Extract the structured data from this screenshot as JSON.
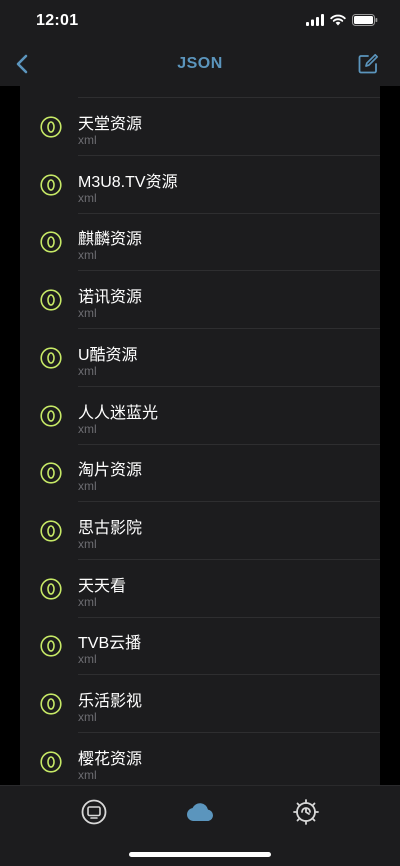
{
  "status_bar": {
    "time": "12:01"
  },
  "nav": {
    "title": "JSON",
    "back_icon": "chevron-left-icon",
    "edit_icon": "compose-icon"
  },
  "colors": {
    "accent": "#5b95bd",
    "item_icon": "#c6e866",
    "cloud": "#5b95bd"
  },
  "sources": [
    {
      "name": "天堂资源",
      "type": "xml"
    },
    {
      "name": "M3U8.TV资源",
      "type": "xml"
    },
    {
      "name": "麒麟资源",
      "type": "xml"
    },
    {
      "name": "诺讯资源",
      "type": "xml"
    },
    {
      "name": "U酷资源",
      "type": "xml"
    },
    {
      "name": "人人迷蓝光",
      "type": "xml"
    },
    {
      "name": "淘片资源",
      "type": "xml"
    },
    {
      "name": "思古影院",
      "type": "xml"
    },
    {
      "name": "天天看",
      "type": "xml"
    },
    {
      "name": "TVB云播",
      "type": "xml"
    },
    {
      "name": "乐活影视",
      "type": "xml"
    },
    {
      "name": "樱花资源",
      "type": "xml"
    }
  ],
  "tab_bar": {
    "tabs": [
      "tv-icon",
      "cloud-icon",
      "settings-gear-icon"
    ],
    "selected": "cloud-icon"
  }
}
